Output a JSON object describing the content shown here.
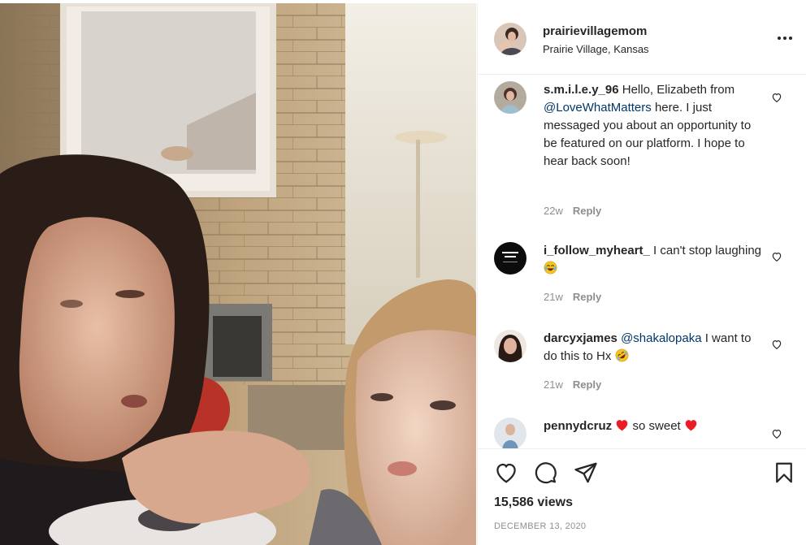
{
  "post": {
    "author": {
      "username": "prairievillagemom",
      "location": "Prairie Village, Kansas",
      "avatar_icon": "profile-photo"
    },
    "more_icon": "more-horizontal-icon",
    "views": "15,586 views",
    "date": "DECEMBER 13, 2020"
  },
  "comments": [
    {
      "username": "s.m.i.l.e.y_96",
      "text_before": " Hello, Elizabeth from ",
      "mention": "@LoveWhatMatters",
      "text_after": " here. I just messaged you about an opportunity to be featured on our platform. I hope to hear back soon!",
      "age": "22w",
      "reply_label": "Reply"
    },
    {
      "username": "i_follow_myheart_",
      "text_before": " I can't stop laughing ",
      "emoji": "face-with-tears-of-joy",
      "age": "21w",
      "reply_label": "Reply"
    },
    {
      "username": "darcyxjames",
      "mention": "@shakalopaka",
      "text_after": " I want to do this to Hx ",
      "emoji": "rolling-on-the-floor-laughing",
      "age": "21w",
      "reply_label": "Reply"
    },
    {
      "username": "pennydcruz",
      "text_middle": " so sweet ",
      "emoji": "red-heart"
    }
  ],
  "action_icons": [
    "like-icon",
    "comment-icon",
    "share-icon",
    "save-icon"
  ],
  "colors": {
    "text": "#262626",
    "secondary": "#8e8e8e",
    "link": "#00376b",
    "border": "#efefef",
    "heart_red": "#ed1c24"
  }
}
